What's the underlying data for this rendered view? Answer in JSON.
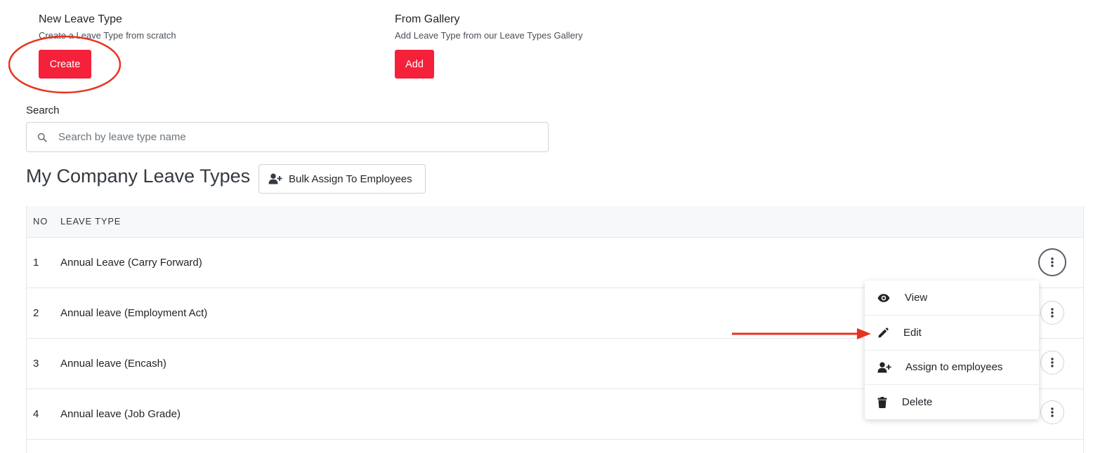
{
  "new_leave_type": {
    "title": "New Leave Type",
    "description": "Create a Leave Type from scratch",
    "button_label": "Create"
  },
  "from_gallery": {
    "title": "From Gallery",
    "description": "Add Leave Type from our Leave Types Gallery",
    "button_label": "Add"
  },
  "search": {
    "label": "Search",
    "placeholder": "Search by leave type name"
  },
  "section": {
    "title": "My Company Leave Types",
    "bulk_assign_label": "Bulk Assign To Employees"
  },
  "table": {
    "columns": [
      "NO",
      "LEAVE TYPE"
    ],
    "rows": [
      {
        "no": "1",
        "type": "Annual Leave (Carry Forward)"
      },
      {
        "no": "2",
        "type": "Annual leave (Employment Act)"
      },
      {
        "no": "3",
        "type": "Annual leave (Encash)"
      },
      {
        "no": "4",
        "type": "Annual leave (Job Grade)"
      }
    ]
  },
  "menu": {
    "items": [
      {
        "label": "View",
        "icon": "eye-icon"
      },
      {
        "label": "Edit",
        "icon": "pencil-icon"
      },
      {
        "label": "Assign to employees",
        "icon": "user-plus-icon"
      },
      {
        "label": "Delete",
        "icon": "trash-icon"
      }
    ]
  },
  "colors": {
    "accent_red": "#f5203a",
    "annotation_red": "#e8321f"
  }
}
